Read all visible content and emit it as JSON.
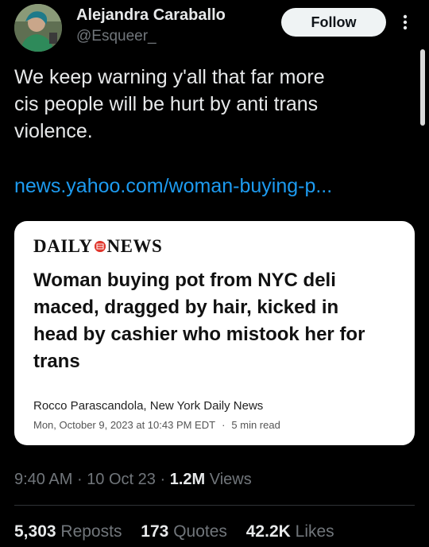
{
  "author": {
    "name": "Alejandra Caraballo",
    "handle": "@Esqueer_"
  },
  "header": {
    "follow_label": "Follow"
  },
  "tweet": {
    "text": "We keep warning y'all that far more\ncis people will be hurt by anti trans\nviolence.",
    "link_text": "news.yahoo.com/woman-buying-p..."
  },
  "card": {
    "publication_left": "DAILY",
    "publication_right": "NEWS",
    "headline": "Woman buying pot from NYC deli maced, dragged by hair, kicked in head by cashier who mistook her for trans",
    "byline": "Rocco Parascandola, New York Daily News",
    "date": "Mon, October 9, 2023 at 10:43 PM EDT",
    "separator": "·",
    "read_time": "5 min read"
  },
  "meta": {
    "time": "9:40 AM",
    "date": "10 Oct 23",
    "separator": "·",
    "views_count": "1.2M",
    "views_label": "Views"
  },
  "stats": {
    "reposts_count": "5,303",
    "reposts_label": "Reposts",
    "quotes_count": "173",
    "quotes_label": "Quotes",
    "likes_count": "42.2K",
    "likes_label": "Likes"
  },
  "colors": {
    "background": "#000000",
    "link": "#1d9bf0",
    "muted": "#71767b",
    "logo_red": "#e0352b"
  }
}
